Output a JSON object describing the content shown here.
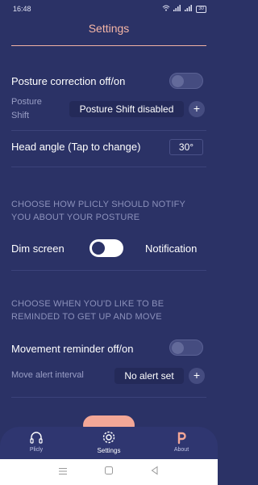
{
  "status": {
    "time": "16:48",
    "battery": "30"
  },
  "header": {
    "title": "Settings"
  },
  "posture": {
    "label": "Posture correction off/on",
    "shift_label": "Posture Shift",
    "shift_value": "Posture Shift disabled",
    "plus": "+",
    "head_angle_label": "Head angle (Tap to change)",
    "head_angle_value": "30°"
  },
  "notify": {
    "heading": "CHOOSE HOW PLICLY SHOULD NOTIFY YOU ABOUT YOUR POSTURE",
    "dim_screen": "Dim screen",
    "notification": "Notification"
  },
  "reminder": {
    "heading": "CHOOSE WHEN YOU'D LIKE TO BE REMINDED TO GET UP AND MOVE",
    "label": "Movement reminder off/on",
    "interval_label": "Move alert interval",
    "interval_value": "No alert set",
    "plus": "+"
  },
  "nav": {
    "items": [
      {
        "label": "Plicly",
        "icon": "headset-icon"
      },
      {
        "label": "Settings",
        "icon": "gear-icon"
      },
      {
        "label": "About",
        "icon": "p-logo-icon"
      }
    ]
  },
  "colors": {
    "background": "#2b3266",
    "accent": "#f3a797"
  }
}
